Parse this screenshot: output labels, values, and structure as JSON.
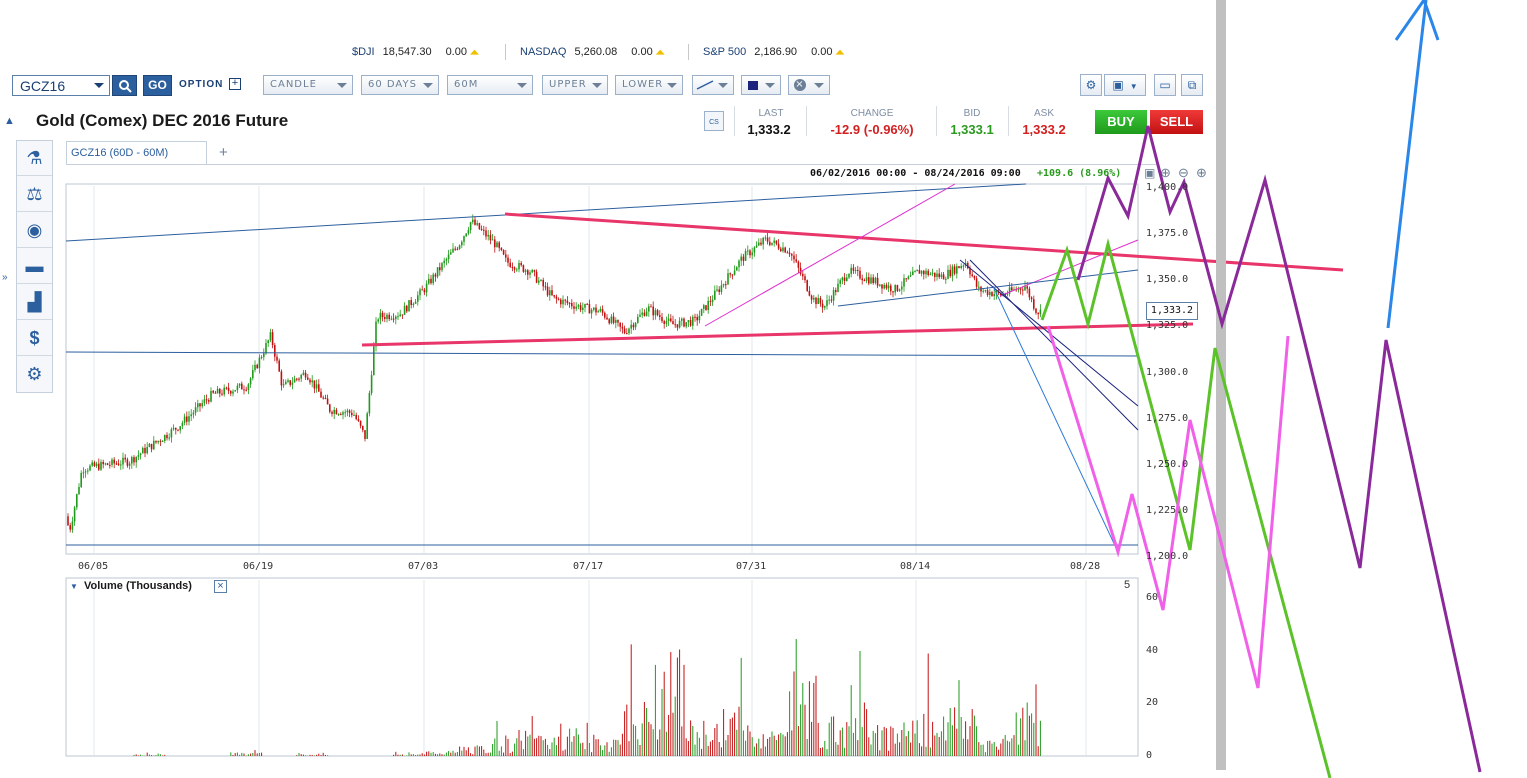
{
  "tickers": [
    {
      "symbol": "$DJI",
      "value": "18,547.30",
      "change": "0.00"
    },
    {
      "symbol": "NASDAQ",
      "value": "5,260.08",
      "change": "0.00"
    },
    {
      "symbol": "S&P 500",
      "value": "2,186.90",
      "change": "0.00"
    }
  ],
  "toolbar": {
    "symbol_value": "GCZ16",
    "go_label": "GO",
    "option_label": "OPTION",
    "chart_type": "CANDLE",
    "range": "60 DAYS",
    "interval": "60M",
    "upper": "UPPER",
    "lower": "LOWER"
  },
  "instrument": {
    "title": "Gold (Comex) DEC 2016 Future"
  },
  "quote": {
    "last_label": "LAST",
    "last": "1,333.2",
    "change_label": "CHANGE",
    "change": "-12.9 (-0.96%)",
    "bid_label": "BID",
    "bid": "1,333.1",
    "ask_label": "ASK",
    "ask": "1,333.2",
    "buy_label": "BUY",
    "sell_label": "SELL",
    "calendar_icon_text": "CS"
  },
  "chart_tab": {
    "label": "GCZ16 (60D - 60M)",
    "add_symbol": "+"
  },
  "chart_header": {
    "date_range": "06/02/2016 00:00 - 08/24/2016 09:00",
    "gain": "+109.6 (8.96%)"
  },
  "last_price_tag": "1,333.2",
  "volume_panel": {
    "title": "Volume (Thousands)",
    "corner_value": "5",
    "y_ticks": [
      "60",
      "40",
      "20",
      "0"
    ]
  },
  "chart_data": {
    "type": "candlestick",
    "x_ticks": [
      "06/05",
      "06/19",
      "07/03",
      "07/17",
      "07/31",
      "08/14",
      "08/28"
    ],
    "y_ticks": [
      "1,400.0",
      "1,375.0",
      "1,350.0",
      "1,325.0",
      "1,300.0",
      "1,275.0",
      "1,250.0",
      "1,225.0",
      "1,200.0"
    ],
    "ylim": [
      1200,
      1400
    ],
    "approx_path_points": [
      [
        "06/02",
        1222
      ],
      [
        "06/03",
        1216
      ],
      [
        "06/04",
        1248
      ],
      [
        "06/08",
        1252
      ],
      [
        "06/12",
        1270
      ],
      [
        "06/15",
        1288
      ],
      [
        "06/18",
        1293
      ],
      [
        "06/20",
        1320
      ],
      [
        "06/21",
        1292
      ],
      [
        "06/23",
        1300
      ],
      [
        "06/25",
        1280
      ],
      [
        "06/27",
        1278
      ],
      [
        "06/28",
        1265
      ],
      [
        "06/29",
        1330
      ],
      [
        "07/01",
        1332
      ],
      [
        "07/03",
        1345
      ],
      [
        "07/05",
        1362
      ],
      [
        "07/06",
        1370
      ],
      [
        "07/07",
        1382
      ],
      [
        "07/09",
        1370
      ],
      [
        "07/10",
        1360
      ],
      [
        "07/12",
        1355
      ],
      [
        "07/14",
        1340
      ],
      [
        "07/16",
        1336
      ],
      [
        "07/18",
        1333
      ],
      [
        "07/20",
        1322
      ],
      [
        "07/22",
        1335
      ],
      [
        "07/24",
        1326
      ],
      [
        "07/26",
        1328
      ],
      [
        "07/28",
        1345
      ],
      [
        "07/30",
        1362
      ],
      [
        "08/01",
        1372
      ],
      [
        "08/03",
        1366
      ],
      [
        "08/05",
        1340
      ],
      [
        "08/06",
        1336
      ],
      [
        "08/08",
        1355
      ],
      [
        "08/10",
        1350
      ],
      [
        "08/12",
        1345
      ],
      [
        "08/14",
        1355
      ],
      [
        "08/16",
        1352
      ],
      [
        "08/18",
        1360
      ],
      [
        "08/19",
        1345
      ],
      [
        "08/21",
        1342
      ],
      [
        "08/23",
        1347
      ],
      [
        "08/24",
        1333
      ]
    ],
    "volume_approx": [
      0,
      0,
      1,
      0,
      0,
      2,
      0,
      1,
      0,
      0,
      1,
      3,
      6,
      10,
      14,
      18,
      12,
      30,
      59,
      20,
      28,
      15,
      47,
      22,
      40,
      18,
      25,
      30,
      12,
      30
    ]
  }
}
